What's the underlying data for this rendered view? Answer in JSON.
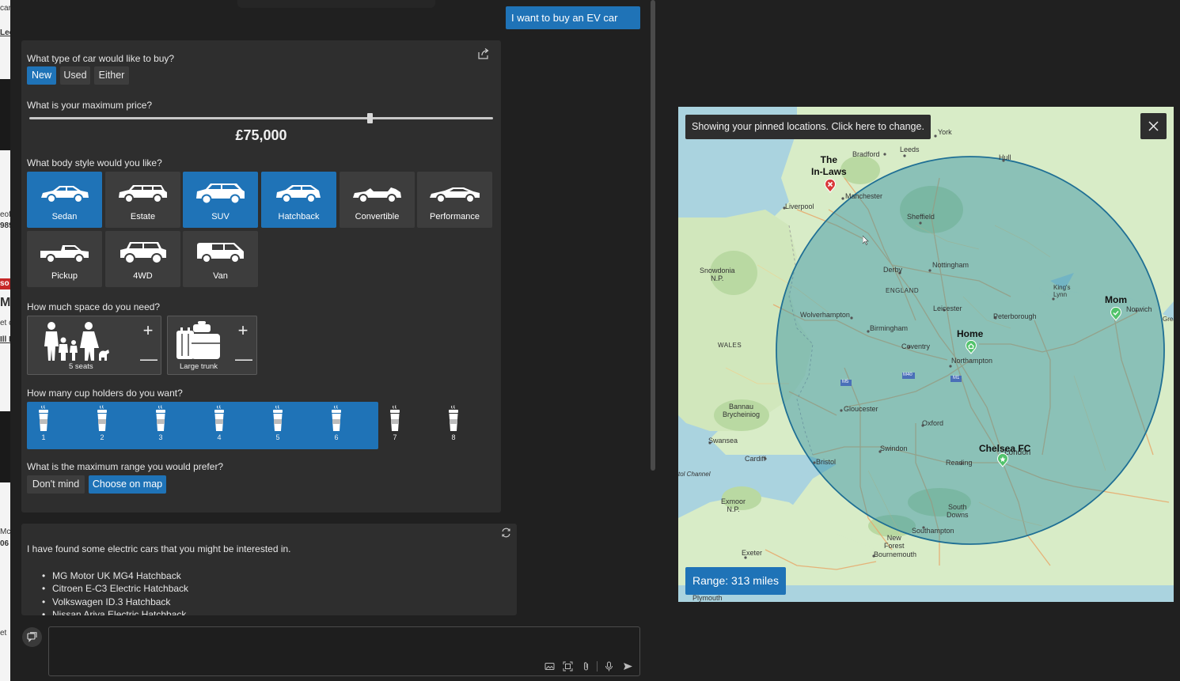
{
  "user_message": "I want to buy an EV car",
  "form": {
    "q_type": "What type of car would like to buy?",
    "type_options": [
      "New",
      "Used",
      "Either"
    ],
    "type_selected": "New",
    "q_price": "What is your maximum price?",
    "price_value": "£75,000",
    "price_slider_fraction": 0.74,
    "q_body": "What body style would you like?",
    "body_styles": [
      {
        "label": "Sedan",
        "selected": true,
        "icon": "sedan-icon"
      },
      {
        "label": "Estate",
        "selected": false,
        "icon": "estate-icon"
      },
      {
        "label": "SUV",
        "selected": true,
        "icon": "suv-icon"
      },
      {
        "label": "Hatchback",
        "selected": true,
        "icon": "hatchback-icon"
      },
      {
        "label": "Convertible",
        "selected": false,
        "icon": "convertible-icon"
      },
      {
        "label": "Performance",
        "selected": false,
        "icon": "performance-icon"
      },
      {
        "label": "Pickup",
        "selected": false,
        "icon": "pickup-icon"
      },
      {
        "label": "4WD",
        "selected": false,
        "icon": "4wd-icon"
      },
      {
        "label": "Van",
        "selected": false,
        "icon": "van-icon"
      }
    ],
    "q_space": "How much space do you need?",
    "seats_label": "5 seats",
    "trunk_label": "Large trunk",
    "q_cups": "How many cup holders do you want?",
    "cup_options": [
      "1",
      "2",
      "3",
      "4",
      "5",
      "6",
      "7",
      "8"
    ],
    "cups_selected": 6,
    "q_range": "What is the maximum range you would prefer?",
    "range_options": [
      "Don't mind",
      "Choose on map"
    ],
    "range_selected": "Choose on map"
  },
  "results": {
    "intro": "I have found some electric cars that you might be interested in.",
    "items": [
      "MG Motor UK MG4 Hatchback",
      "Citroen E-C3 Electric Hatchback",
      "Volkswagen ID.3 Hatchback",
      "Nissan Ariya Electric Hatchback"
    ]
  },
  "map": {
    "banner": "Showing your pinned locations. Click here to change.",
    "range_label": "Range: 313 miles",
    "pins": {
      "in_laws": "The\nIn-Laws",
      "home": "Home",
      "mom": "Mom",
      "chelsea": "Chelsea FC"
    },
    "cities": {
      "york": "York",
      "leeds": "Leeds",
      "bradford": "Bradford",
      "hull": "Hull",
      "manchester": "Manchester",
      "liverpool": "Liverpool",
      "sheffield": "Sheffield",
      "snowdonia": "Snowdonia\nN.P.",
      "derby": "Derby",
      "nottingham": "Nottingham",
      "england": "ENGLAND",
      "kings_lynn": "King's\nLynn",
      "norwich": "Norwich",
      "great": "Great",
      "wolverhampton": "Wolverhampton",
      "leicester": "Leicester",
      "peterborough": "Peterborough",
      "birmingham": "Birmingham",
      "wales": "WALES",
      "coventry": "Coventry",
      "northampton": "Northampton",
      "m5": "M5",
      "m40": "M40",
      "m1": "M1",
      "bannau": "Bannau\nBrycheiniog",
      "gloucester": "Gloucester",
      "oxford": "Oxford",
      "swansea": "Swansea",
      "cardiff": "Cardiff",
      "swindon": "Swindon",
      "bristol": "Bristol",
      "london": "London",
      "reading": "Reading",
      "bristol_channel": "tol Channel",
      "exmoor": "Exmoor\nN.P.",
      "south_downs": "South\nDowns",
      "southampton": "Southampton",
      "new_forest": "New\nForest",
      "exeter": "Exeter",
      "bournemouth": "Bournemouth",
      "plymouth": "Plymouth"
    },
    "colors": {
      "accent": "#1f73b7",
      "land": "#d8ecc7",
      "sea": "#aad3df",
      "circle": "#3d8fb0"
    }
  },
  "left_strip_text": [
    "car",
    "Lec",
    "eof",
    "989",
    "so",
    "M",
    "et c",
    "Ill M",
    "Mc",
    "06",
    "et"
  ]
}
